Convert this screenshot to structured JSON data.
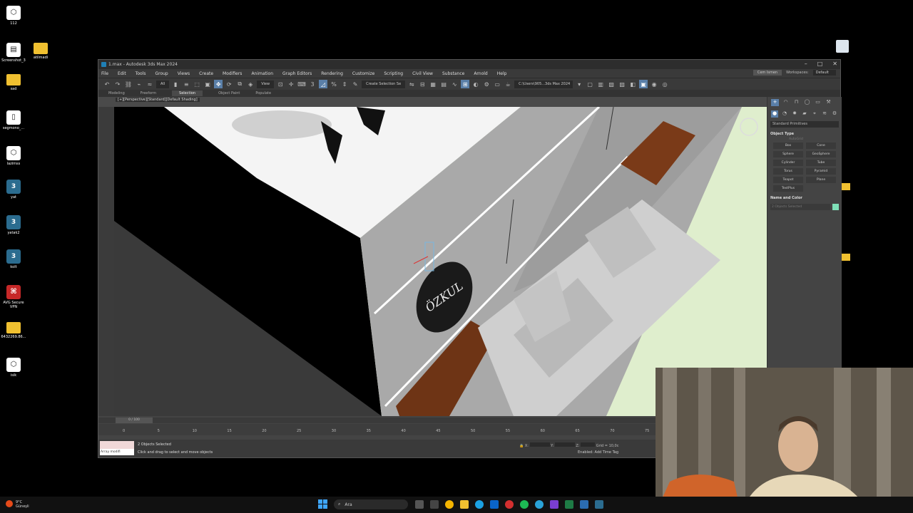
{
  "desktop": {
    "icons": [
      {
        "label": "112",
        "kind": "doc",
        "glyph": "⬡"
      },
      {
        "label": "Screenshot_3",
        "kind": "doc",
        "glyph": "▤"
      },
      {
        "label": "atilmadi",
        "kind": "folder",
        "glyph": ""
      },
      {
        "label": "sad",
        "kind": "folder",
        "glyph": ""
      },
      {
        "label": "segmono_...",
        "kind": "doc",
        "glyph": "▯"
      },
      {
        "label": "lazimss",
        "kind": "doc",
        "glyph": "⬡"
      },
      {
        "label": "yat",
        "kind": "max",
        "glyph": "3"
      },
      {
        "label": "yatak2",
        "kind": "max",
        "glyph": "3"
      },
      {
        "label": "kolt",
        "kind": "max",
        "glyph": "3"
      },
      {
        "label": "AVG Secure VPN",
        "kind": "avg",
        "glyph": "⌘"
      },
      {
        "label": "6432269.86...",
        "kind": "folder",
        "glyph": ""
      },
      {
        "label": "isik",
        "kind": "doc",
        "glyph": "⬡"
      }
    ]
  },
  "window": {
    "title": "1.max - Autodesk 3ds Max 2024"
  },
  "menubar": {
    "items": [
      "File",
      "Edit",
      "Tools",
      "Group",
      "Views",
      "Create",
      "Modifiers",
      "Animation",
      "Graph Editors",
      "Rendering",
      "Customize",
      "Scripting",
      "Civil View",
      "Substance",
      "Arnold",
      "Help"
    ],
    "user": "Cem Ismen",
    "workspaces_label": "Workspaces:",
    "workspace": "Default"
  },
  "toolbar": {
    "filter_value": "All",
    "selection_set_placeholder": "Create Selection Se",
    "project_path": "C:\\Users\\905...3ds Max 2024"
  },
  "ribbon": {
    "tabs": [
      "Modeling",
      "Freeform",
      "Selection",
      "Object Paint",
      "Populate"
    ],
    "active_tab": "Selection"
  },
  "viewport": {
    "label_parts": [
      "[+]",
      "[Perspective]",
      "[Standard]",
      "[Default Shading]"
    ],
    "sign_text": "ÖZKUL"
  },
  "command_panel": {
    "category": "Standard Primitives",
    "object_type_header": "Object Type",
    "autogrid": "AutoGrid",
    "primitives": [
      "Box",
      "Cone",
      "Sphere",
      "GeoSphere",
      "Cylinder",
      "Tube",
      "Torus",
      "Pyramid",
      "Teapot",
      "Plane",
      "TextPlus"
    ],
    "name_color_header": "Name and Color",
    "name_value": "2 Objects Selected",
    "object_color": "#7fe0b8"
  },
  "timeline": {
    "slider": "0 / 100",
    "ticks": [
      "0",
      "5",
      "10",
      "15",
      "20",
      "25",
      "30",
      "35",
      "40",
      "45",
      "50",
      "55",
      "60",
      "65",
      "70",
      "75"
    ]
  },
  "status": {
    "script_line": "Array modifi",
    "selection": "2 Objects Selected",
    "prompt": "Click and drag to select and move objects",
    "x_label": "X:",
    "y_label": "Y:",
    "z_label": "Z:",
    "grid": "Grid = 10,0c",
    "enabled": "Enabled:",
    "add_time_tag": "Add Time Tag"
  },
  "taskbar": {
    "weather_temp": "9°C",
    "weather_text": "Güneşli",
    "search_label": "Ara"
  }
}
